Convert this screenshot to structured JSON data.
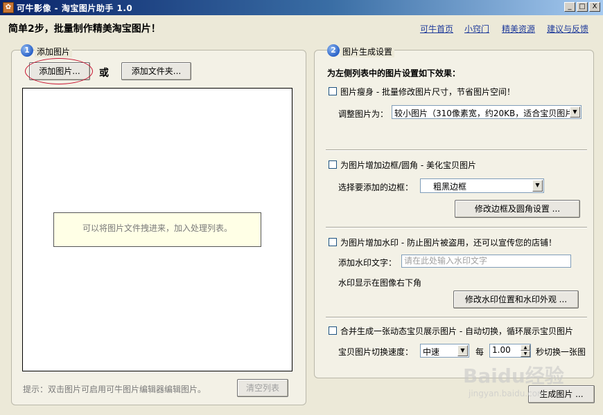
{
  "window": {
    "title": "可牛影像 - 淘宝图片助手 1.0",
    "icon": "app-logo-icon",
    "controls": {
      "minimize": "_",
      "maximize": "□",
      "close": "X"
    }
  },
  "header": {
    "tagline": "简单2步，批量制作精美淘宝图片！",
    "links": [
      "可牛首页",
      "小窍门",
      "精美资源",
      "建议与反馈"
    ]
  },
  "step1": {
    "number": "1",
    "title": "添加图片",
    "add_image_button": "添加图片...",
    "or_label": "或",
    "add_folder_button": "添加文件夹...",
    "drop_hint": "可以将图片文件拽进来，加入处理列表。",
    "footer_hint": "提示：双击图片可启用可牛图片编辑器编辑图片。",
    "clear_button": "清空列表"
  },
  "step2": {
    "number": "2",
    "title": "图片生成设置",
    "heading": "为左侧列表中的图片设置如下效果：",
    "resize": {
      "checkbox_label": "图片瘦身 - 批量修改图片尺寸，节省图片空间！",
      "field_label": "调整图片为：",
      "selected": "较小图片（310像素宽，约20KB，适合宝贝图片）"
    },
    "border": {
      "checkbox_label": "为图片增加边框/圆角 - 美化宝贝图片",
      "field_label": "选择要添加的边框：",
      "selected": "粗黑边框",
      "settings_button": "修改边框及圆角设置 ..."
    },
    "watermark": {
      "checkbox_label": "为图片增加水印 - 防止图片被盗用，还可以宣传您的店铺！",
      "field_label": "添加水印文字：",
      "placeholder": "请在此处输入水印文字",
      "position_note": "水印显示在图像右下角",
      "settings_button": "修改水印位置和水印外观 ..."
    },
    "animation": {
      "checkbox_label": "合并生成一张动态宝贝展示图片 - 自动切换，循环展示宝贝图片",
      "speed_label": "宝贝图片切换速度：",
      "speed_selected": "中速",
      "every_label": "每",
      "seconds_value": "1.00",
      "suffix_label": "秒切换一张图"
    }
  },
  "generate_button": "生成图片 ...",
  "watermark_overlay": {
    "logo": "Baidu经验",
    "url": "jingyan.baidu.com"
  },
  "colors": {
    "titlebar_start": "#0a246a",
    "link": "#1e3a9a",
    "highlight_oval": "#c8102e",
    "window_bg": "#ece9d8"
  }
}
